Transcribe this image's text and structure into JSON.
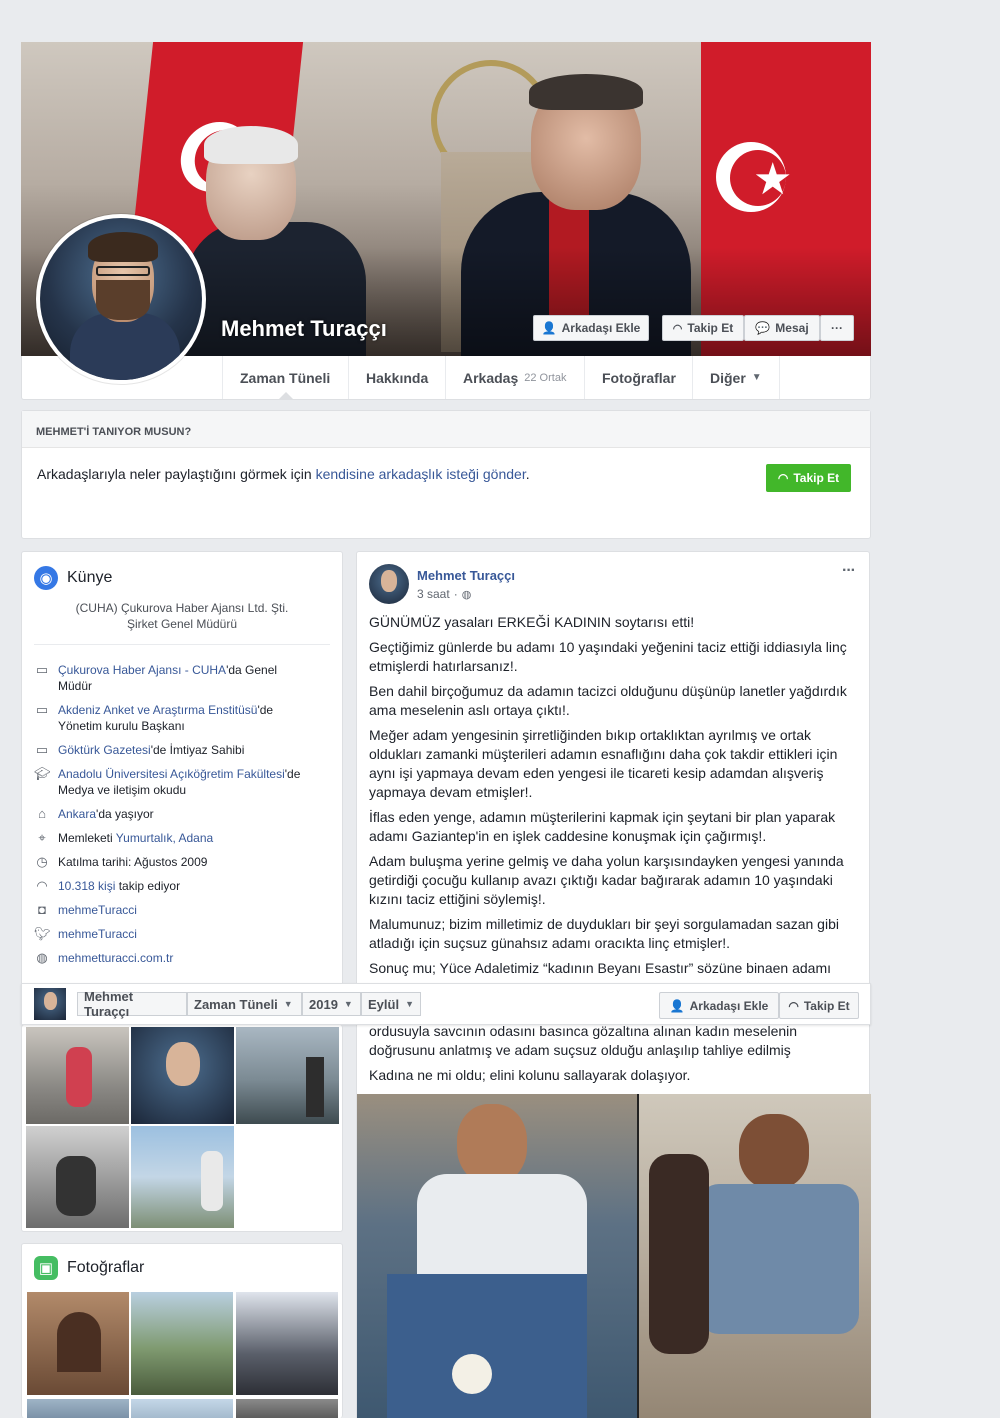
{
  "profile": {
    "name": "Mehmet Turaççı"
  },
  "cover_actions": {
    "add_friend": "Arkadaşı Ekle",
    "follow": "Takip Et",
    "message": "Mesaj",
    "more": "···"
  },
  "tabs": {
    "timeline": "Zaman Tüneli",
    "about": "Hakkında",
    "friends": "Arkadaş",
    "friends_sub": "22 Ortak",
    "photos": "Fotoğraflar",
    "more": "Diğer"
  },
  "know": {
    "heading": "MEHMET'İ TANIYOR MUSUN?",
    "text_before": "Arkadaşlarıyla neler paylaştığını görmek için ",
    "link": "kendisine arkadaşlık isteği gönder",
    "text_after": ".",
    "follow_button": "Takip Et"
  },
  "intro": {
    "title": "Künye",
    "bio_line1": "(CUHA) Çukurova Haber Ajansı Ltd. Şti.",
    "bio_line2": "Şirket Genel Müdürü",
    "items": [
      {
        "link": "Çukurova Haber Ajansı - CUHA",
        "text": "'da Genel",
        "line2": "Müdür"
      },
      {
        "link": "Akdeniz Anket ve Araştırma Enstitüsü",
        "text": "'de",
        "line2": "Yönetim kurulu Başkanı"
      },
      {
        "link": "Göktürk Gazetesi",
        "text": "'de İmtiyaz Sahibi",
        "line2": ""
      },
      {
        "link": "Anadolu Üniversitesi Açıköğretim Fakültesi",
        "text": "'de",
        "line2": "Medya ve iletişim okudu"
      },
      {
        "link": "Ankara",
        "text": "'da yaşıyor",
        "line2": ""
      },
      {
        "prefix": "Memleketi ",
        "link": "Yumurtalık, Adana",
        "text": "",
        "line2": ""
      },
      {
        "prefix": "Katılma tarihi: Ağustos 2009",
        "link": "",
        "text": "",
        "line2": ""
      },
      {
        "link": "10.318 kişi",
        "text": " takip ediyor",
        "line2": ""
      },
      {
        "link": "mehmeTuracci",
        "text": "",
        "line2": ""
      },
      {
        "link": "mehmeTuracci",
        "text": "",
        "line2": ""
      },
      {
        "link": "mehmetturacci.com.tr",
        "text": "",
        "line2": ""
      }
    ],
    "icons": [
      "briefcase-icon",
      "briefcase-icon",
      "briefcase-icon",
      "graduation-cap-icon",
      "home-icon",
      "map-pin-icon",
      "clock-icon",
      "rss-icon",
      "instagram-icon",
      "twitter-icon",
      "globe-icon"
    ]
  },
  "photos_section": {
    "title": "Fotoğraflar"
  },
  "post": {
    "author": "Mehmet Turaççı",
    "time": "3 saat",
    "more": "···",
    "paragraphs": [
      "GÜNÜMÜZ yasaları ERKEĞİ KADININ soytarısı etti!",
      "Geçtiğimiz günlerde bu adamı 10 yaşındaki yeğenini taciz ettiği iddiasıyla linç etmişlerdi hatırlarsanız!.",
      "Ben dahil birçoğumuz da adamın tacizci olduğunu düşünüp lanetler yağdırdık ama meselenin aslı ortaya çıktı!.",
      "Meğer adam yengesinin şirretliğinden bıkıp ortaklıktan ayrılmış ve ortak oldukları zamanki müşterileri adamın esnaflığını daha çok takdir ettikleri için aynı işi yapmaya devam eden yengesi ile ticareti kesip adamdan alışveriş yapmaya devam etmişler!.",
      "İflas eden yenge, adamın müşterilerini kapmak için şeytani bir plan yaparak adamı Gaziantep'in en işlek caddesine konuşmak için çağırmış!.",
      "Adam buluşma yerine gelmiş ve daha yolun karşısındayken yengesi yanında getirdiği çocuğu kullanıp avazı çıktığı kadar bağırarak adamın 10 yaşındaki kızını taciz ettiğini söylemiş!.",
      "Malumunuz; bizim milletimiz de duydukları bir şeyi sorgulamadan sazan gibi atladığı için suçsuz günahsız adamı oracıkta linç etmişler!.",
      "Sonuç mu; Yüce Adaletimiz “kadının Beyanı Esastır” sözüne binaen adamı",
      "ordusuyla savcının odasını basınca gözaltına alınan kadın meselenin doğrusunu anlatmış ve adam suçsuz olduğu anlaşılıp tahliye edilmiş",
      "Kadına ne mi oldu; elini kolunu sallayarak dolaşıyor."
    ]
  },
  "sticky": {
    "name": "Mehmet Turaççı",
    "timeline": "Zaman Tüneli",
    "year": "2019",
    "month": "Eylül",
    "add_friend": "Arkadaşı Ekle",
    "follow": "Takip Et"
  },
  "colors": {
    "accent": "#385898",
    "green": "#42b72a",
    "background": "#e9ebee"
  }
}
